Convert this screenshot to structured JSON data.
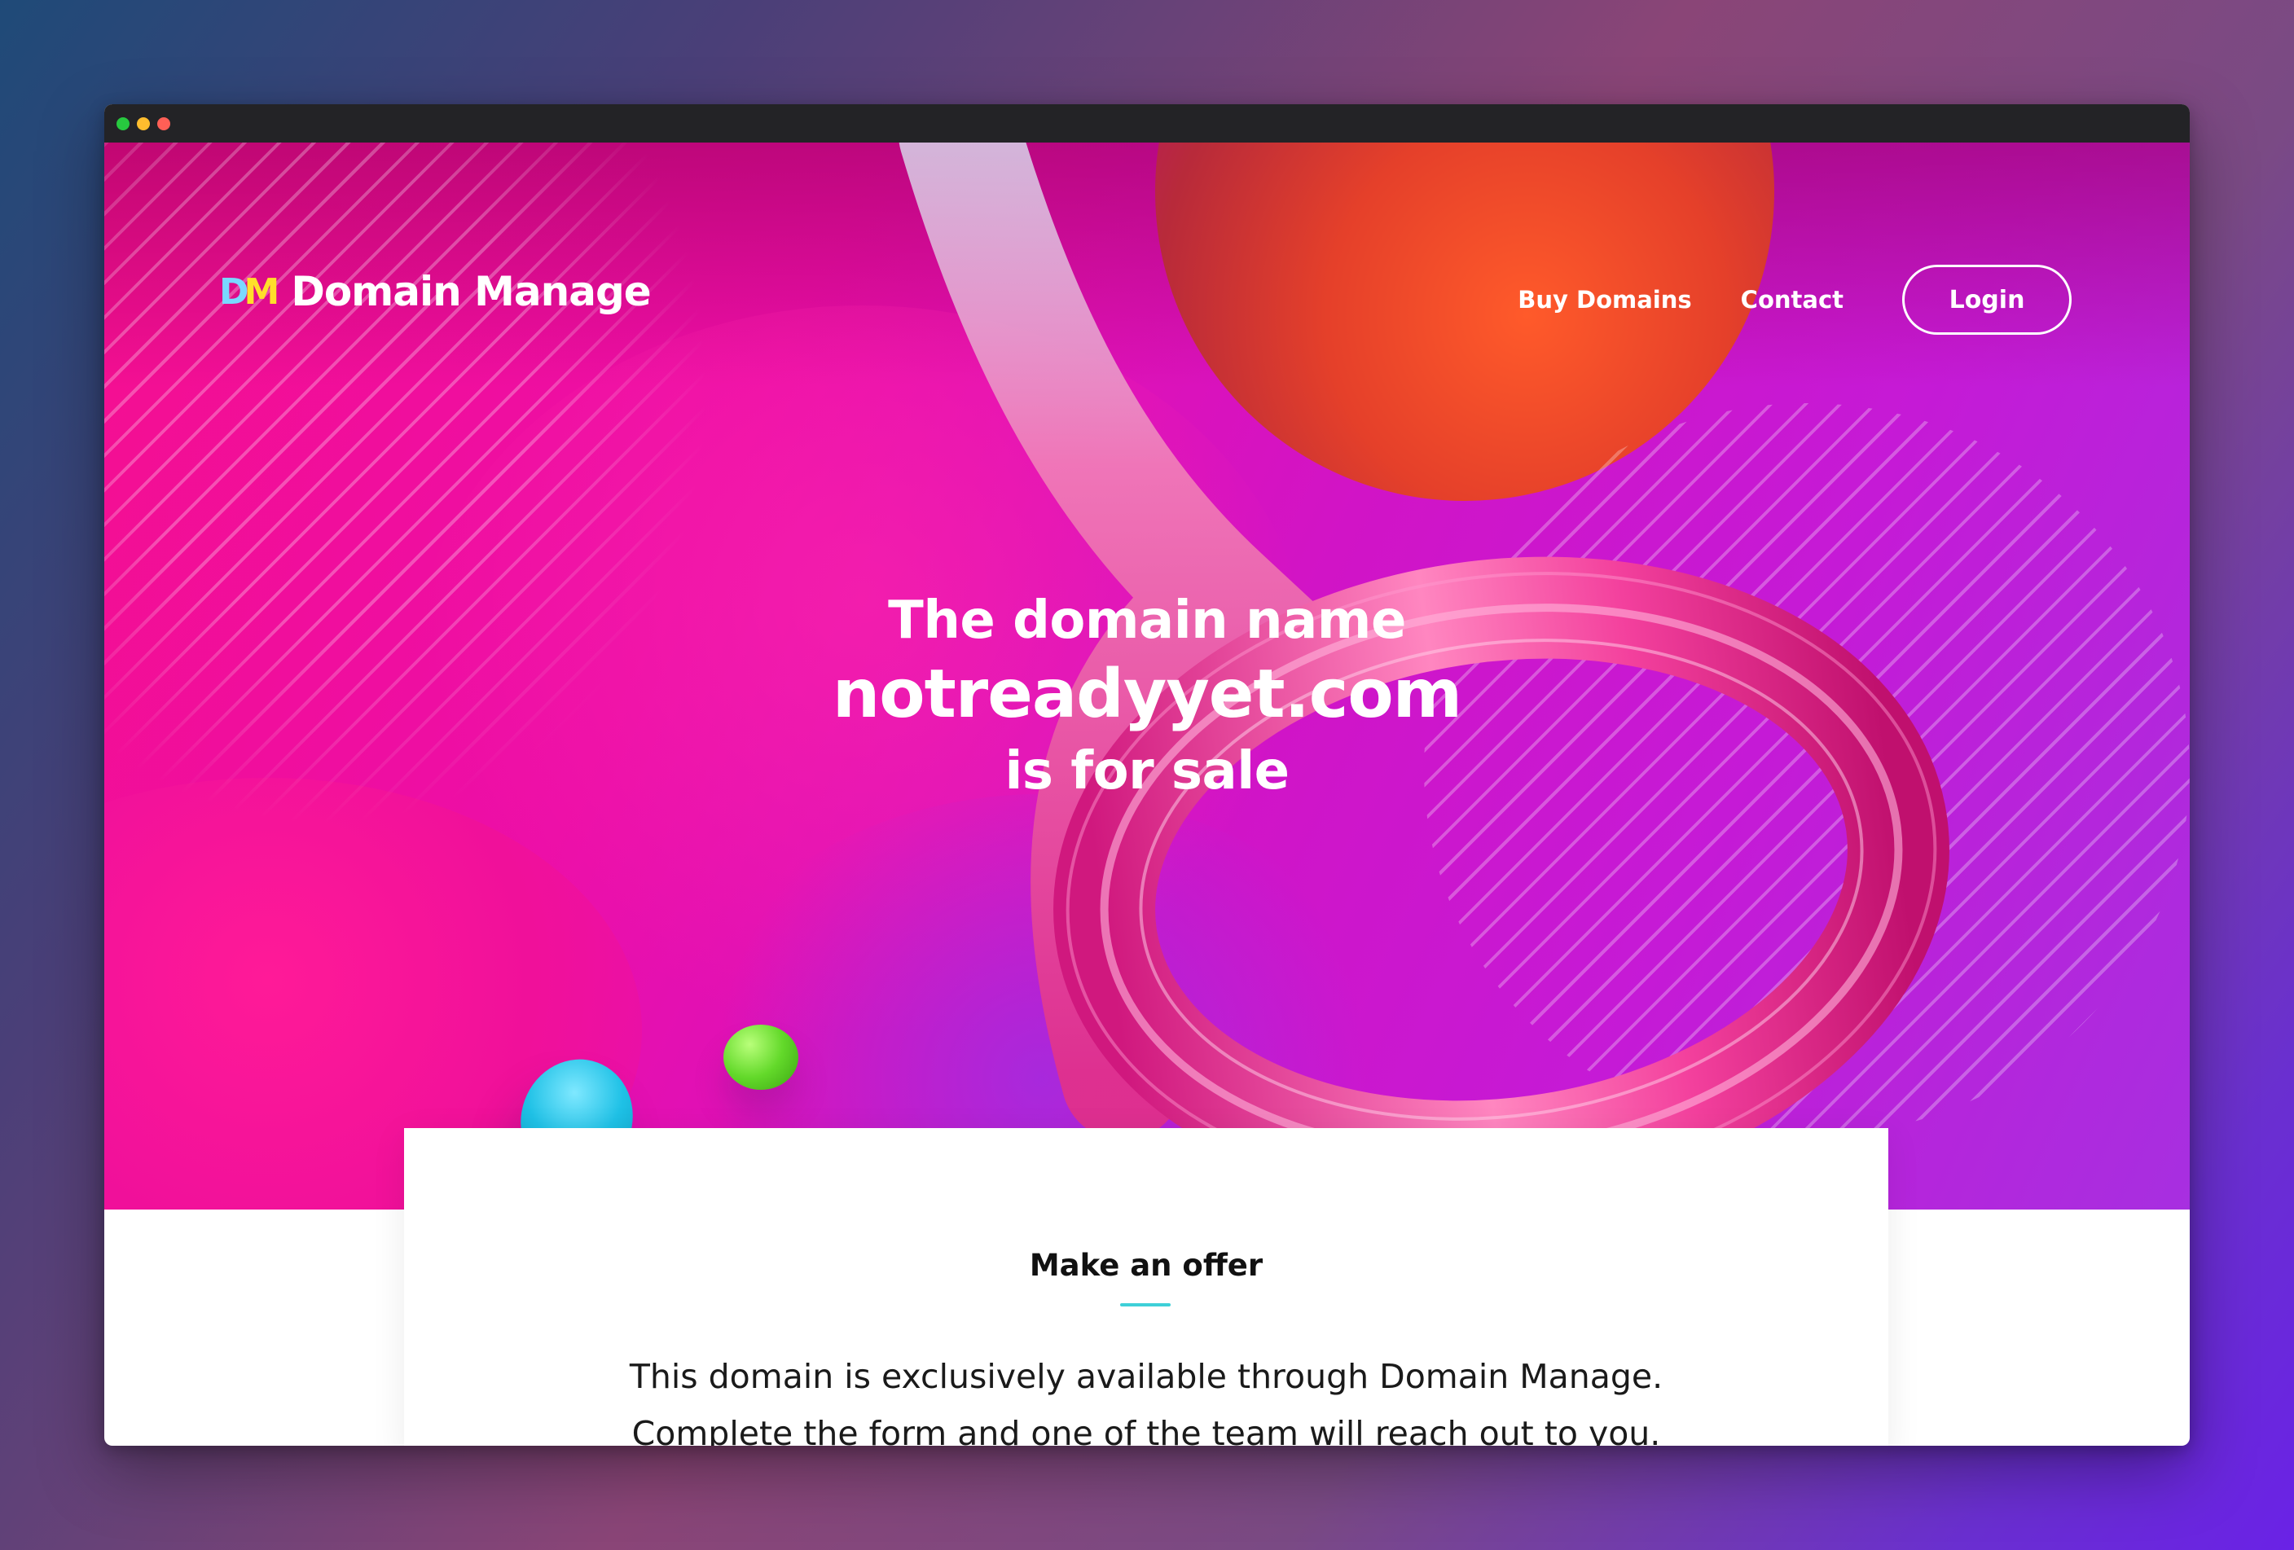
{
  "window": {
    "controls": [
      "green",
      "yellow",
      "red"
    ]
  },
  "nav": {
    "logo_mark_d": "D",
    "logo_mark_m": "M",
    "logo_text": "Domain Manage",
    "links": [
      {
        "label": "Buy Domains"
      },
      {
        "label": "Contact"
      }
    ],
    "login_label": "Login"
  },
  "hero": {
    "line1": "The domain name",
    "domain": "notreadyyet.com",
    "line3": "is for sale"
  },
  "offer": {
    "title": "Make an offer",
    "description_line1": "This domain is exclusively available through Domain Manage.",
    "description_line2": "Complete the form and one of the team will reach out to you."
  },
  "colors": {
    "accent_teal": "#3ed0d8",
    "logo_blue": "#7ad8ff",
    "logo_yellow": "#ffdf2a",
    "hero_pink": "#f50f8f",
    "hero_purple": "#c51ad6"
  }
}
